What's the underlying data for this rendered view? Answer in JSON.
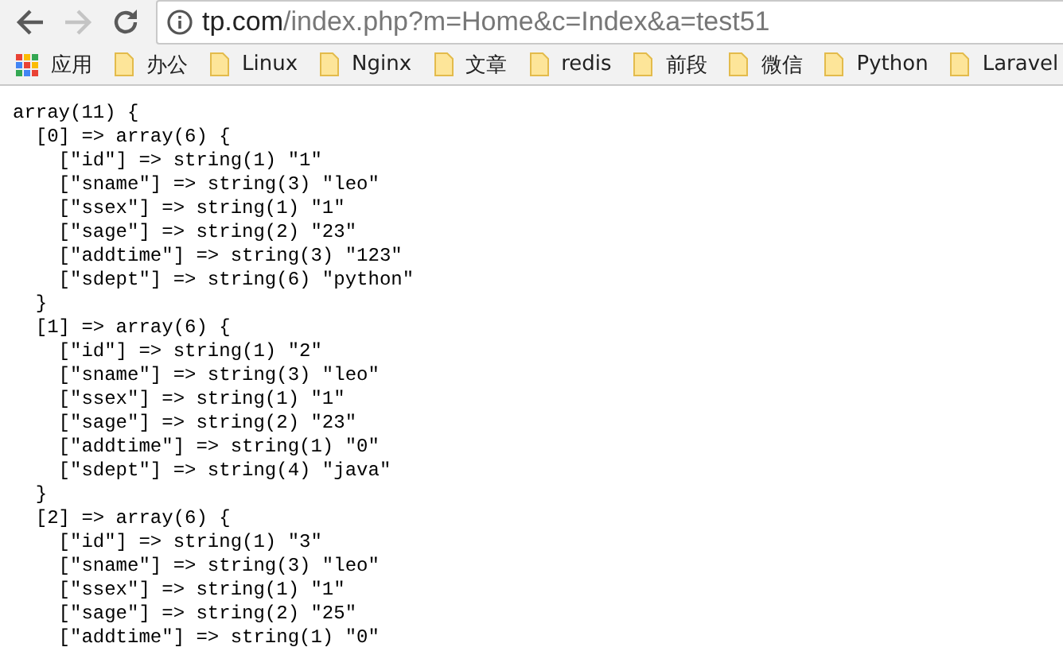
{
  "toolbar": {
    "back": {
      "disabled": false
    },
    "forward": {
      "disabled": true
    },
    "url": {
      "host": "tp.com",
      "path": "/index.php?m=Home&c=Index&a=test51"
    }
  },
  "bookmarks": [
    {
      "kind": "apps",
      "label": "应用"
    },
    {
      "kind": "folder",
      "label": "办公"
    },
    {
      "kind": "folder",
      "label": "Linux"
    },
    {
      "kind": "folder",
      "label": "Nginx"
    },
    {
      "kind": "folder",
      "label": "文章"
    },
    {
      "kind": "folder",
      "label": "redis"
    },
    {
      "kind": "folder",
      "label": "前段"
    },
    {
      "kind": "folder",
      "label": "微信"
    },
    {
      "kind": "folder",
      "label": "Python"
    },
    {
      "kind": "folder",
      "label": "Laravel"
    }
  ],
  "output": [
    "array(11) {",
    "  [0] => array(6) {",
    "    [\"id\"] => string(1) \"1\"",
    "    [\"sname\"] => string(3) \"leo\"",
    "    [\"ssex\"] => string(1) \"1\"",
    "    [\"sage\"] => string(2) \"23\"",
    "    [\"addtime\"] => string(3) \"123\"",
    "    [\"sdept\"] => string(6) \"python\"",
    "  }",
    "  [1] => array(6) {",
    "    [\"id\"] => string(1) \"2\"",
    "    [\"sname\"] => string(3) \"leo\"",
    "    [\"ssex\"] => string(1) \"1\"",
    "    [\"sage\"] => string(2) \"23\"",
    "    [\"addtime\"] => string(1) \"0\"",
    "    [\"sdept\"] => string(4) \"java\"",
    "  }",
    "  [2] => array(6) {",
    "    [\"id\"] => string(1) \"3\"",
    "    [\"sname\"] => string(3) \"leo\"",
    "    [\"ssex\"] => string(1) \"1\"",
    "    [\"sage\"] => string(2) \"25\"",
    "    [\"addtime\"] => string(1) \"0\""
  ]
}
